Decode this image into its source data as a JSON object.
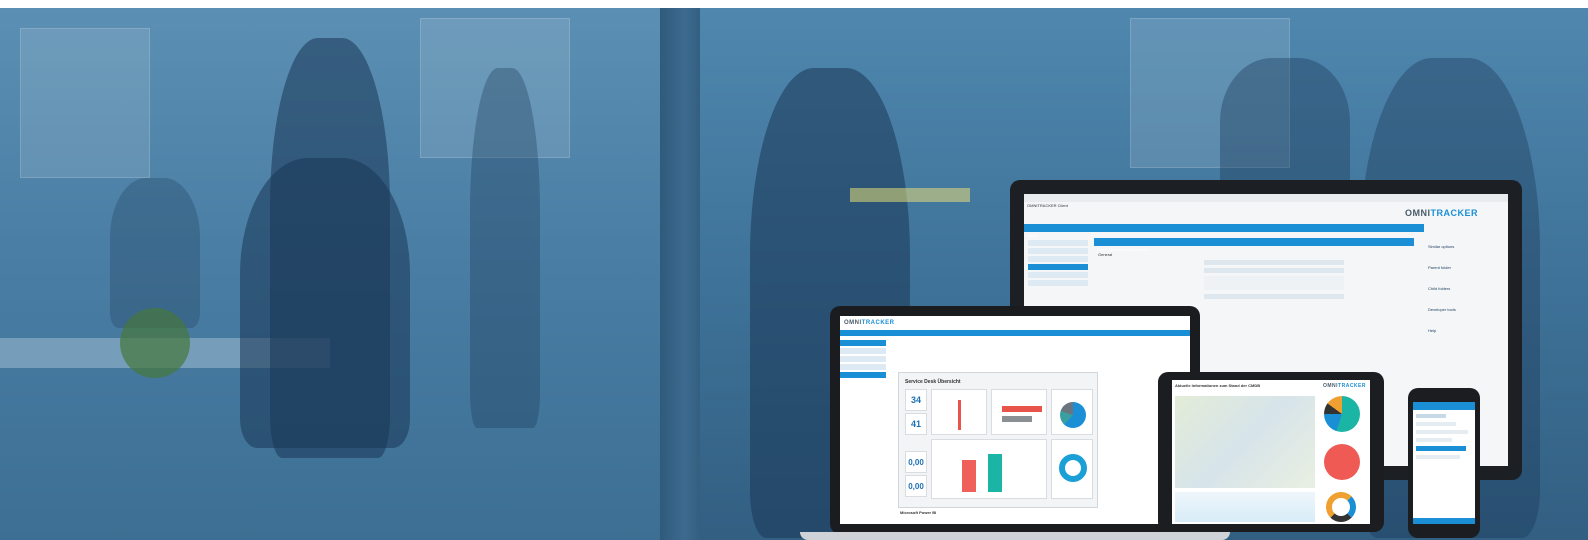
{
  "monitor": {
    "app_title": "OMNITRACKER Client",
    "section": "Fields",
    "field_heading": "Field \"Assessment Comment\"",
    "group_label": "General",
    "brand": {
      "main": "OMNI",
      "accent": "TRACKER"
    },
    "right_panel": [
      "Similar options",
      "Parent folder",
      "Child folders",
      "Developer tools",
      "Help"
    ]
  },
  "laptop": {
    "brand": {
      "main": "OMNI",
      "accent": "TRACKER"
    },
    "dashboard_title": "Service Desk Übersicht",
    "kpis": [
      "34",
      "41",
      "0,00",
      "0,00"
    ],
    "footer": "Microsoft Power BI"
  },
  "tablet": {
    "header": "Aktuelle Informationen zum Stand der CMDB",
    "brand": {
      "main": "OMNI",
      "accent": "TRACKER"
    }
  },
  "colors": {
    "accent": "#1a8fd6",
    "overlay": "#3a6f95"
  }
}
